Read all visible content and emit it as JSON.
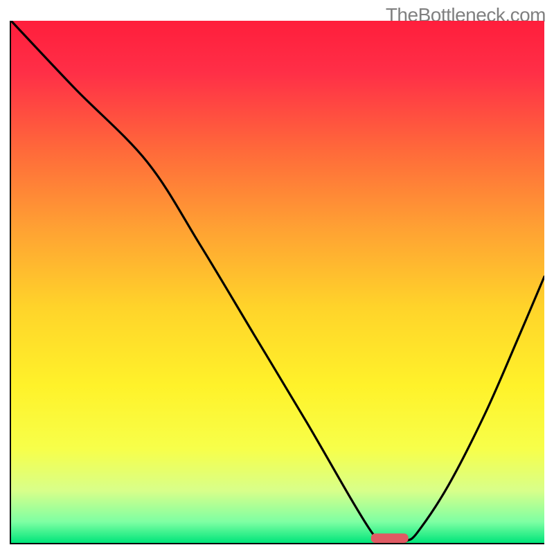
{
  "watermark": "TheBottleneck.com",
  "chart_data": {
    "type": "line",
    "title": "",
    "xlabel": "",
    "ylabel": "",
    "x_range": [
      0,
      1000
    ],
    "y_range": [
      0,
      1000
    ],
    "xlim": [
      0,
      1000
    ],
    "ylim": [
      0,
      1000
    ],
    "grid": false,
    "legend_position": "none",
    "note": "Curve drawn from estimated normalized coordinates (0..1000 in both axes, y increases upward). Black line dips to ~0 around x≈700 then rises again.",
    "curve_points_xy": [
      [
        0,
        1000
      ],
      [
        120,
        870
      ],
      [
        255,
        730
      ],
      [
        355,
        570
      ],
      [
        455,
        400
      ],
      [
        555,
        230
      ],
      [
        640,
        80
      ],
      [
        678,
        18
      ],
      [
        695,
        4
      ],
      [
        710,
        0
      ],
      [
        730,
        0
      ],
      [
        742,
        4
      ],
      [
        762,
        20
      ],
      [
        820,
        110
      ],
      [
        890,
        250
      ],
      [
        950,
        390
      ],
      [
        1000,
        510
      ]
    ],
    "marker": {
      "x_center": 710,
      "width": 70,
      "height": 18,
      "color": "#e05a63"
    },
    "background_gradient_stops": [
      {
        "offset": 0.0,
        "color": "#ff1e3c"
      },
      {
        "offset": 0.1,
        "color": "#ff2f47"
      },
      {
        "offset": 0.25,
        "color": "#ff6a3a"
      },
      {
        "offset": 0.4,
        "color": "#ffa233"
      },
      {
        "offset": 0.55,
        "color": "#ffd42a"
      },
      {
        "offset": 0.7,
        "color": "#fff22a"
      },
      {
        "offset": 0.82,
        "color": "#f7ff4a"
      },
      {
        "offset": 0.9,
        "color": "#d8ff8a"
      },
      {
        "offset": 0.96,
        "color": "#7dffa3"
      },
      {
        "offset": 1.0,
        "color": "#00e57a"
      }
    ]
  }
}
